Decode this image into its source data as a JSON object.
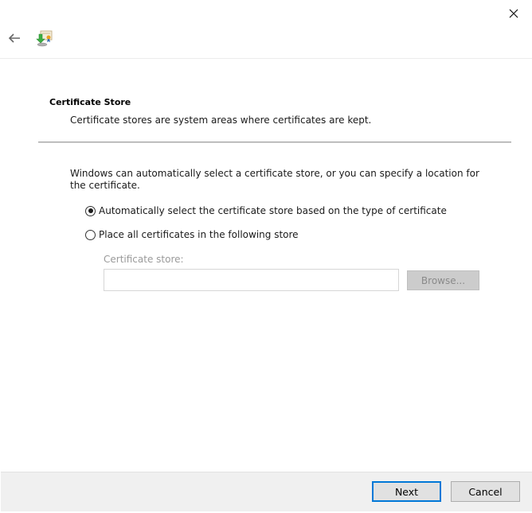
{
  "window": {
    "close_icon": "close-icon",
    "back_icon": "back-arrow-icon",
    "wizard_icon": "certificate-import-icon"
  },
  "section": {
    "title": "Certificate Store",
    "description": "Certificate stores are system areas where certificates are kept."
  },
  "content": {
    "intro": "Windows can automatically select a certificate store, or you can specify a location for the certificate.",
    "options": [
      {
        "label": "Automatically select the certificate store based on the type of certificate",
        "checked": true
      },
      {
        "label": "Place all certificates in the following store",
        "checked": false
      }
    ],
    "store_label": "Certificate store:",
    "store_value": "",
    "browse_label": "Browse..."
  },
  "footer": {
    "next_label": "Next",
    "cancel_label": "Cancel"
  },
  "colors": {
    "accent": "#0078d7",
    "footer_bg": "#f0f0f0",
    "disabled_text": "#9a9a9a"
  }
}
